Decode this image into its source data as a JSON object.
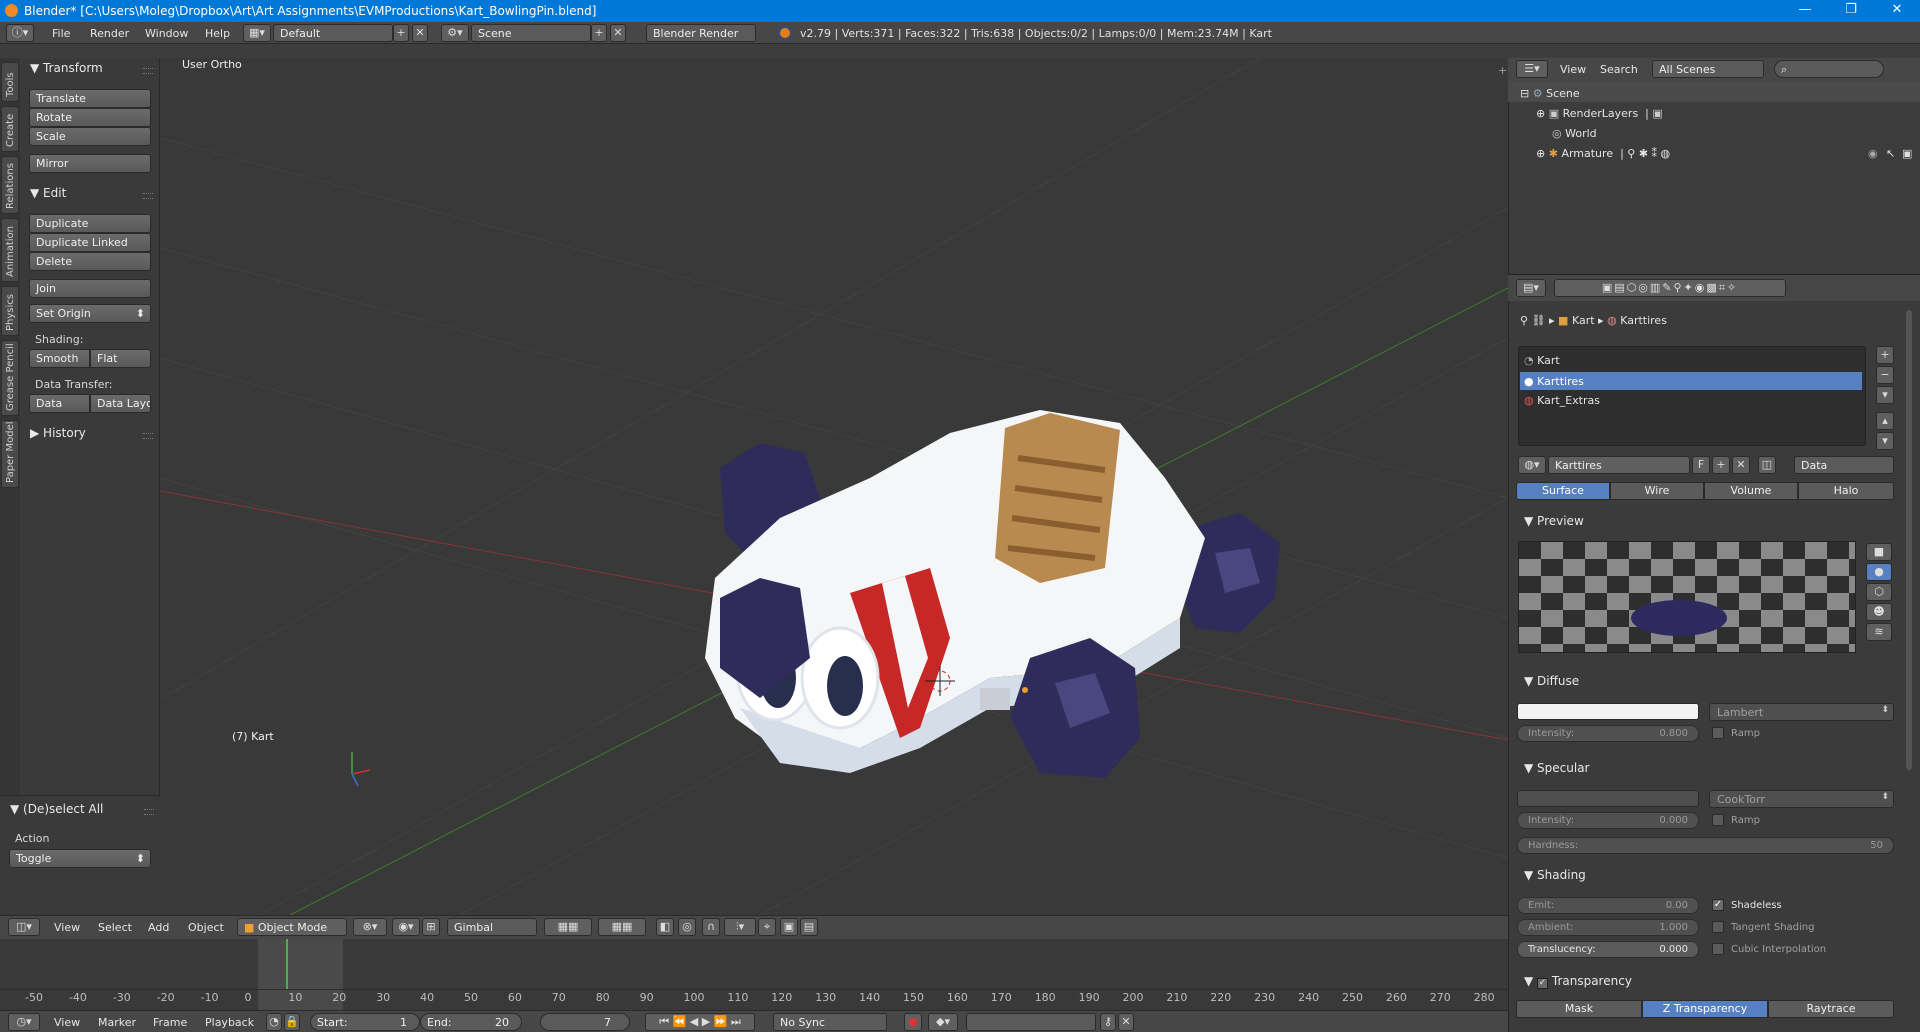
{
  "window": {
    "title": "Blender* [C:\\Users\\Moleg\\Dropbox\\Art\\Art Assignments\\EVMProductions\\Kart_BowlingPin.blend]",
    "minimize": "—",
    "maximize": "❐",
    "close": "✕"
  },
  "info_header": {
    "menus": [
      "File",
      "Render",
      "Window",
      "Help"
    ],
    "screen_layout": "Default",
    "scene": "Scene",
    "render_engine": "Blender Render",
    "stats": "v2.79 | Verts:371 | Faces:322 | Tris:638 | Objects:0/2 | Lamps:0/0 | Mem:23.74M | Kart"
  },
  "tool_tabs": [
    "Tools",
    "Create",
    "Relations",
    "Animation",
    "Physics",
    "Grease Pencil",
    "Paper Model"
  ],
  "tool_shelf": {
    "transform": {
      "header": "Transform",
      "buttons": [
        "Translate",
        "Rotate",
        "Scale",
        "Mirror"
      ]
    },
    "edit": {
      "header": "Edit",
      "buttons": [
        "Duplicate",
        "Duplicate Linked",
        "Delete",
        "Join",
        "Set Origin"
      ]
    },
    "shading": {
      "label": "Shading:",
      "smooth": "Smooth",
      "flat": "Flat"
    },
    "data_transfer": {
      "label": "Data Transfer:",
      "data": "Data",
      "data_layo": "Data Layo"
    },
    "history": {
      "header": "History"
    }
  },
  "last_operator": {
    "header": "(De)select All",
    "action_label": "Action",
    "action_value": "Toggle"
  },
  "viewport": {
    "view_label": "User Ortho",
    "object_label": "(7) Kart"
  },
  "view3d_header": {
    "menus": [
      "View",
      "Select",
      "Add",
      "Object"
    ],
    "mode": "Object Mode",
    "orientation": "Gimbal"
  },
  "timeline": {
    "ruler": [
      "-50",
      "-40",
      "-30",
      "-20",
      "-10",
      "0",
      "10",
      "20",
      "30",
      "40",
      "50",
      "60",
      "70",
      "80",
      "90",
      "100",
      "110",
      "120",
      "130",
      "140",
      "150",
      "160",
      "170",
      "180",
      "190",
      "200",
      "210",
      "220",
      "230",
      "240",
      "250",
      "260",
      "270",
      "280"
    ],
    "current_frame_marker": 7,
    "menus": [
      "View",
      "Marker",
      "Frame",
      "Playback"
    ],
    "start_label": "Start:",
    "start_value": "1",
    "end_label": "End:",
    "end_value": "20",
    "current_frame": "7",
    "sync": "No Sync"
  },
  "outliner": {
    "menus": [
      "View",
      "Search"
    ],
    "filter": "All Scenes",
    "items": [
      "Scene",
      "RenderLayers",
      "World",
      "Armature"
    ]
  },
  "properties": {
    "breadcrumb": [
      "Kart",
      "Karttires"
    ],
    "material_slots": [
      "Kart",
      "Karttires",
      "Kart_Extras"
    ],
    "selected_slot": 1,
    "material_name": "Karttires",
    "fake_user": "F",
    "link": "Data",
    "tabs": [
      "Surface",
      "Wire",
      "Volume",
      "Halo"
    ],
    "active_tab": 0,
    "preview_header": "Preview",
    "diffuse": {
      "header": "Diffuse",
      "shader": "Lambert",
      "intensity_label": "Intensity:",
      "intensity": "0.800",
      "ramp": "Ramp"
    },
    "specular": {
      "header": "Specular",
      "shader": "CookTorr",
      "intensity_label": "Intensity:",
      "intensity": "0.000",
      "ramp": "Ramp",
      "hardness_label": "Hardness:",
      "hardness": "50"
    },
    "shading": {
      "header": "Shading",
      "emit_label": "Emit:",
      "emit": "0.00",
      "ambient_label": "Ambient:",
      "ambient": "1.000",
      "translucency_label": "Translucency:",
      "translucency": "0.000",
      "shadeless": "Shadeless",
      "tangent": "Tangent Shading",
      "cubic": "Cubic Interpolation"
    },
    "transparency": {
      "header": "Transparency",
      "modes": [
        "Mask",
        "Z Transparency",
        "Raytrace"
      ],
      "active_mode": 1
    }
  },
  "colors": {
    "title_bar": "#0078d7",
    "selection": "#5680c2",
    "viewport_bg": "#393939",
    "x_axis": "#8a3232",
    "y_axis": "#3f7a2c"
  }
}
